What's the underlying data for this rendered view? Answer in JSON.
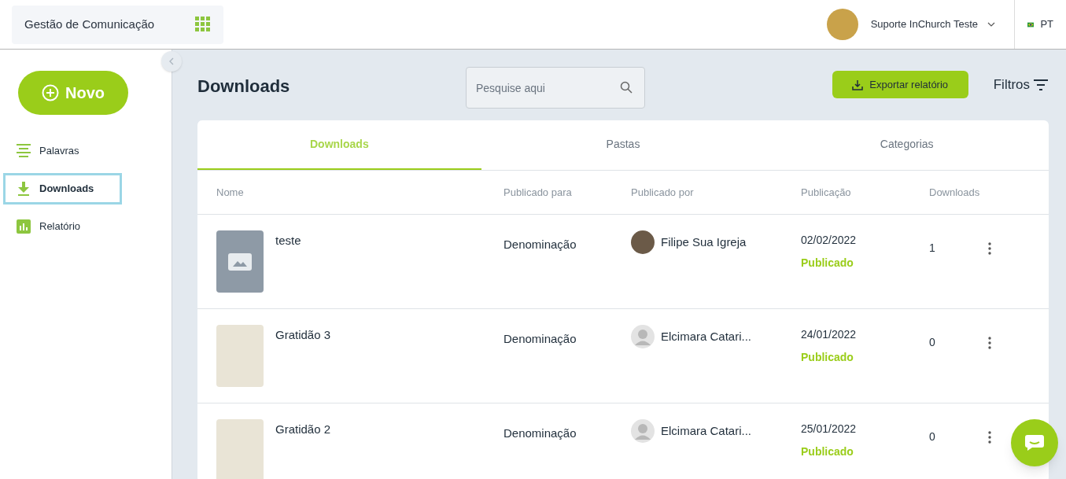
{
  "header": {
    "app_title": "Gestão de Comunicação",
    "user_name": "Suporte InChurch Teste",
    "language": "PT"
  },
  "sidebar": {
    "new_button": "Novo",
    "items": [
      {
        "label": "Palavras",
        "kind": "lines",
        "selected": false
      },
      {
        "label": "Downloads",
        "kind": "download",
        "selected": true
      },
      {
        "label": "Relatório",
        "kind": "chart",
        "selected": false
      }
    ]
  },
  "page": {
    "title": "Downloads",
    "search": {
      "placeholder": "Pesquise aqui"
    },
    "export_button": "Exportar relatório",
    "filters_button": "Filtros"
  },
  "tabs": [
    {
      "label": "Downloads",
      "selected": true
    },
    {
      "label": "Pastas",
      "selected": false
    },
    {
      "label": "Categorias",
      "selected": false
    }
  ],
  "table": {
    "columns": [
      "Nome",
      "Publicado para",
      "Publicado por",
      "Publicação",
      "Downloads"
    ],
    "rows": [
      {
        "name": "teste",
        "thumbnail": {
          "kind": "placeholder"
        },
        "audience": "Denominação",
        "author": "Filipe Sua Igreja",
        "avatar": {
          "kind": "photo"
        },
        "date": "02/02/2022",
        "status": "Publicado",
        "downloads": "1"
      },
      {
        "name": "Gratidão 3",
        "thumbnail": {
          "kind": "photo"
        },
        "audience": "Denominação",
        "author": "Elcimara Catari...",
        "avatar": {
          "kind": "generic"
        },
        "date": "24/01/2022",
        "status": "Publicado",
        "downloads": "0"
      },
      {
        "name": "Gratidão 2",
        "thumbnail": {
          "kind": "photo"
        },
        "audience": "Denominação",
        "author": "Elcimara Catari...",
        "avatar": {
          "kind": "generic"
        },
        "date": "25/01/2022",
        "status": "Publicado",
        "downloads": "0"
      }
    ]
  }
}
